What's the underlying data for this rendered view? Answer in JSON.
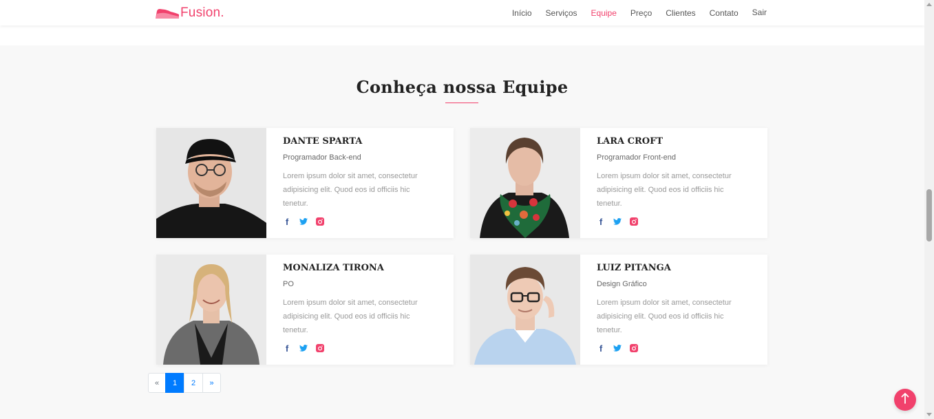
{
  "brand": {
    "name": "Fusion.",
    "color": "#f1416c"
  },
  "nav": {
    "items": [
      {
        "label": "Início"
      },
      {
        "label": "Serviços"
      },
      {
        "label": "Equipe",
        "active": true
      },
      {
        "label": "Preço"
      },
      {
        "label": "Clientes"
      },
      {
        "label": "Contato"
      },
      {
        "label": "Sair"
      }
    ]
  },
  "section": {
    "title": "Conheça nossa Equipe"
  },
  "team": [
    {
      "name": "DANTE SPARTA",
      "role": "Programador Back-end",
      "description": "Lorem ipsum dolor sit amet, consectetur adipisicing elit. Quod eos id officiis hic tenetur.",
      "socials": [
        "facebook-icon",
        "twitter-icon",
        "instagram-icon"
      ]
    },
    {
      "name": "LARA CROFT",
      "role": "Programador Front-end",
      "description": "Lorem ipsum dolor sit amet, consectetur adipisicing elit. Quod eos id officiis hic tenetur.",
      "socials": [
        "facebook-icon",
        "twitter-icon",
        "instagram-icon"
      ]
    },
    {
      "name": "MONALIZA TIRONA",
      "role": "PO",
      "description": "Lorem ipsum dolor sit amet, consectetur adipisicing elit. Quod eos id officiis hic tenetur.",
      "socials": [
        "facebook-icon",
        "twitter-icon",
        "instagram-icon"
      ]
    },
    {
      "name": "LUIZ PITANGA",
      "role": "Design Gráfico",
      "description": "Lorem ipsum dolor sit amet, consectetur adipisicing elit. Quod eos id officiis hic tenetur.",
      "socials": [
        "facebook-icon",
        "twitter-icon",
        "instagram-icon"
      ]
    }
  ],
  "pagination": {
    "prev": "«",
    "pages": [
      "1",
      "2"
    ],
    "current": "1",
    "next": "»"
  },
  "back_to_top": {
    "icon": "arrow-up-icon"
  },
  "colors": {
    "accent": "#f1416c",
    "pagination_active": "#007bff",
    "facebook": "#3b5998",
    "twitter": "#1da1f2",
    "instagram": "#f1416c"
  }
}
